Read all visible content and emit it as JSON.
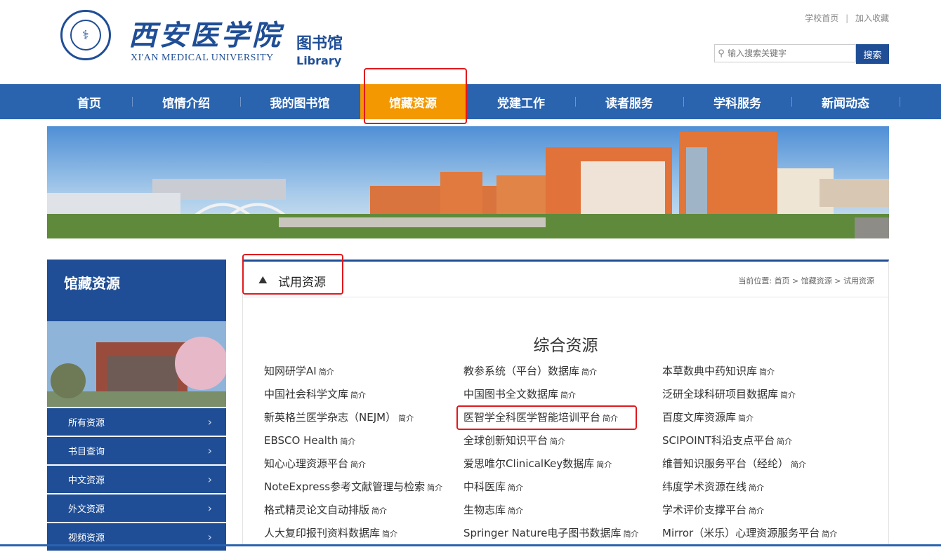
{
  "header": {
    "top_links": [
      "学校首页",
      "加入收藏"
    ],
    "university_cn": "西安医学院",
    "university_en": "XI'AN MEDICAL UNIVERSITY",
    "library_cn": "图书馆",
    "library_en": "Library",
    "search_placeholder": "输入搜索关键字",
    "search_button": "搜索"
  },
  "nav": {
    "items": [
      "首页",
      "馆情介绍",
      "我的图书馆",
      "馆藏资源",
      "党建工作",
      "读者服务",
      "学科服务",
      "新闻动态"
    ],
    "active_index": 3,
    "active_color": "#f39800",
    "bar_color": "#2a63ae"
  },
  "sidebar": {
    "title": "馆藏资源",
    "items": [
      "所有资源",
      "书目查询",
      "中文资源",
      "外文资源",
      "视频资源"
    ]
  },
  "content": {
    "section_title": "试用资源",
    "breadcrumb": {
      "label": "当前位置:",
      "path": [
        "首页",
        "馆藏资源",
        "试用资源"
      ]
    },
    "category_title": "综合资源",
    "intro_label": "简介",
    "columns": [
      [
        "知网研学AI",
        "中国社会科学文库",
        "新英格兰医学杂志（NEJM）",
        "EBSCO Health",
        "知心心理资源平台",
        "NoteExpress参考文献管理与检索",
        "格式精灵论文自动排版",
        "人大复印报刊资料数据库"
      ],
      [
        "教参系统（平台）数据库",
        "中国图书全文数据库",
        "医智学全科医学智能培训平台",
        "全球创新知识平台",
        "爱思唯尔ClinicalKey数据库",
        "中科医库",
        "生物志库",
        "Springer Nature电子图书数据库"
      ],
      [
        "本草数典中药知识库",
        "泛研全球科研项目数据库",
        "百度文库资源库",
        "SCIPOINT科沿支点平台",
        "维普知识服务平台（经纶）",
        "纬度学术资源在线",
        "学术评价支撑平台",
        "Mirror（米乐）心理资源服务平台"
      ]
    ]
  },
  "colors": {
    "primary": "#1f4e96",
    "highlight_box": "#e0191e"
  }
}
